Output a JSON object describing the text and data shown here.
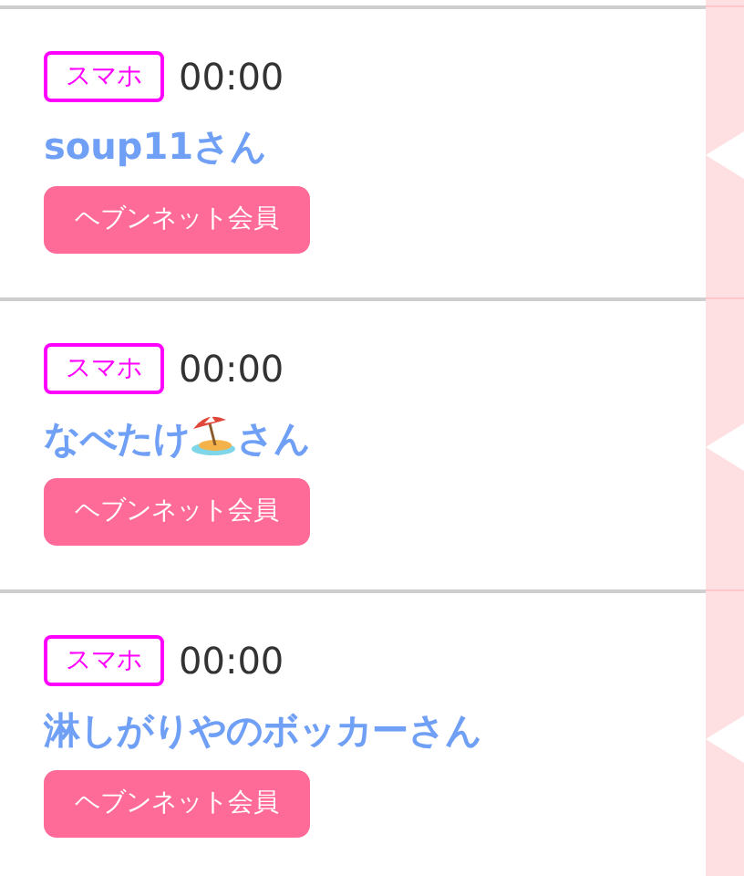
{
  "entries": [
    {
      "device": "スマホ",
      "time": "00:00",
      "name": [
        {
          "kind": "text",
          "text": "soup11さん"
        }
      ],
      "member": "ヘブンネット会員"
    },
    {
      "device": "スマホ",
      "time": "00:00",
      "name": [
        {
          "kind": "text",
          "text": "なべたけ"
        },
        {
          "kind": "icon"
        },
        {
          "kind": "text",
          "text": "さん"
        }
      ],
      "member": "ヘブンネット会員"
    },
    {
      "device": "スマホ",
      "time": "00:00",
      "name": [
        {
          "kind": "text",
          "text": "淋しがりやのボッカーさん"
        }
      ],
      "member": "ヘブンネット会員"
    }
  ]
}
